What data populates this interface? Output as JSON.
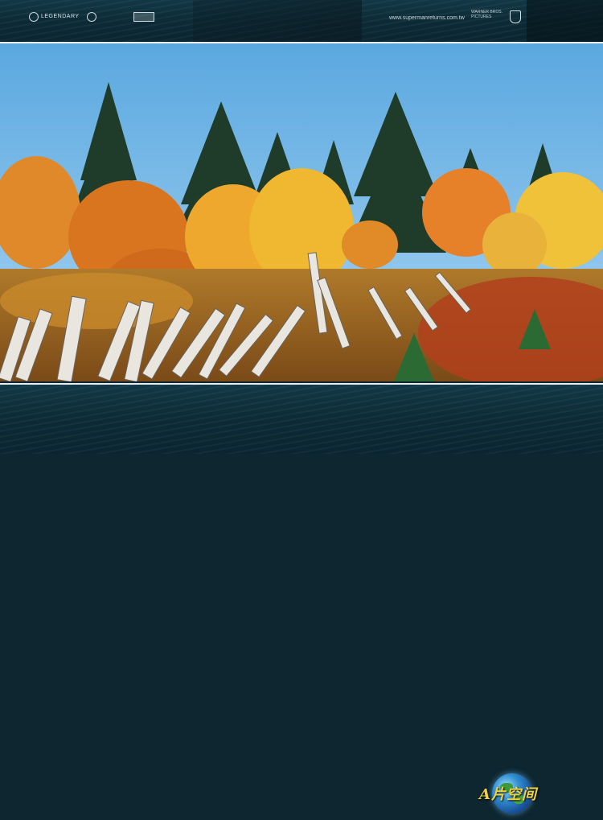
{
  "header": {
    "logo_left": "LEGENDARY",
    "website": "www.supermanreturns.com.tw",
    "studio_credit": "WARNER BROS. PICTURES"
  },
  "photo": {
    "subject": "autumn forest scene"
  },
  "footer": {
    "brand_text": "A片空间"
  },
  "colors": {
    "band": "#0c2b36",
    "sky": "#6fb4e6",
    "foliage_orange": "#e0892a",
    "foliage_yellow": "#f0c23a",
    "pine": "#1f3b2a",
    "birch": "#e8e6df",
    "brand_text": "#f2d23c"
  }
}
